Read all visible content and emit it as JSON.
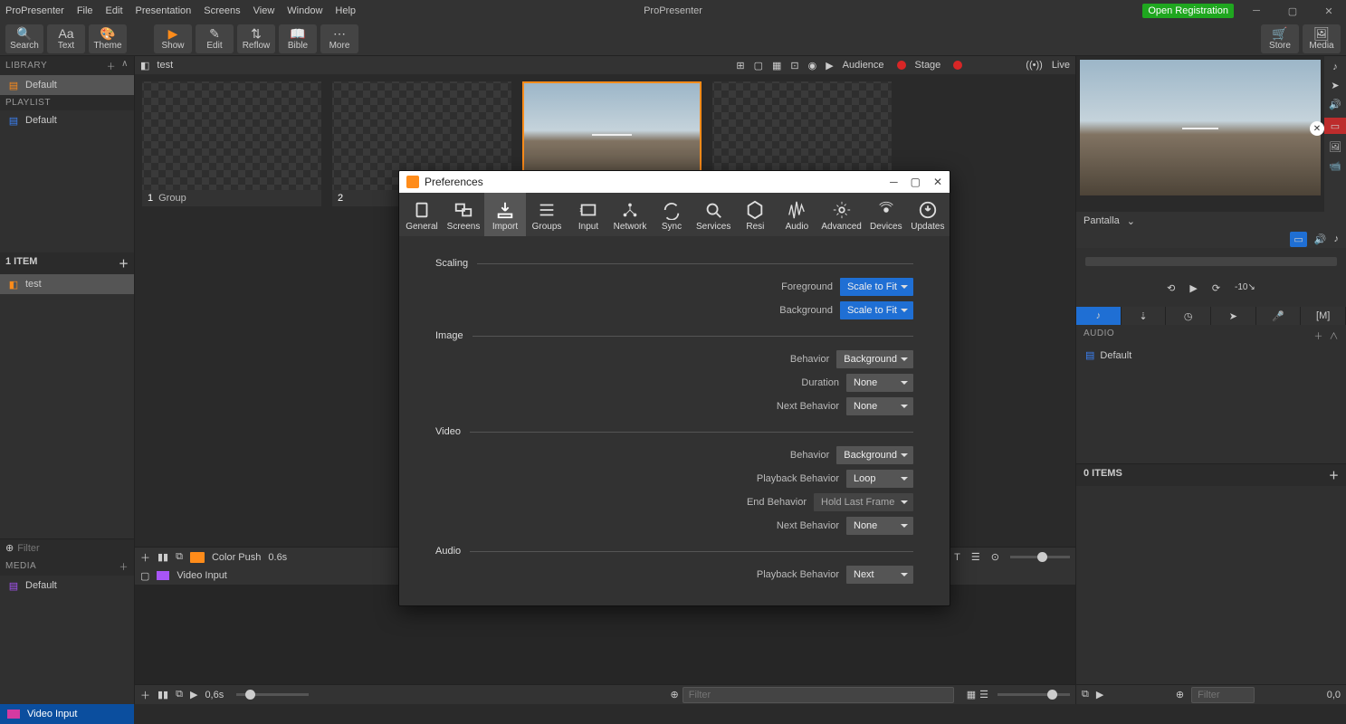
{
  "app": {
    "name": "ProPresenter",
    "title": "ProPresenter"
  },
  "menu": [
    "ProPresenter",
    "File",
    "Edit",
    "Presentation",
    "Screens",
    "View",
    "Window",
    "Help"
  ],
  "badge": "Open Registration",
  "toolbar": {
    "search": "Search",
    "text": "Text",
    "theme": "Theme",
    "show": "Show",
    "edit": "Edit",
    "reflow": "Reflow",
    "bible": "Bible",
    "more": "More",
    "store": "Store",
    "media": "Media"
  },
  "sidebar": {
    "library_label": "LIBRARY",
    "library_item": "Default",
    "playlist_label": "PLAYLIST",
    "playlist_item": "Default",
    "items_count": "1 ITEM",
    "item_name": "test",
    "filter_placeholder": "Filter",
    "media_label": "MEDIA",
    "media_item": "Default"
  },
  "center": {
    "doc_name": "test",
    "audience": "Audience",
    "stage": "Stage",
    "live": "Live",
    "slides": [
      {
        "num": "1",
        "grp": "Group"
      },
      {
        "num": "2",
        "grp": ""
      },
      {
        "num": "",
        "grp": ""
      },
      {
        "num": "",
        "grp": ""
      }
    ],
    "foot_transition": "Color Push",
    "foot_time": "0.6s"
  },
  "video_input": {
    "label": "Video Input",
    "time": "0,6s",
    "filter_placeholder": "Filter"
  },
  "right": {
    "output_label": "Pantalla",
    "audio_head": "AUDIO",
    "audio_item": "Default",
    "zero_items": "0 ITEMS",
    "filter_placeholder": "Filter",
    "coord": "0,0"
  },
  "status": {
    "label": "Video Input"
  },
  "modal": {
    "title": "Preferences",
    "tabs": [
      "General",
      "Screens",
      "Import",
      "Groups",
      "Input",
      "Network",
      "Sync",
      "Services",
      "Resi",
      "Audio",
      "Advanced",
      "Devices",
      "Updates"
    ],
    "sections": {
      "scaling": "Scaling",
      "image": "Image",
      "video": "Video",
      "audio": "Audio",
      "foreground": "Foreground",
      "background": "Background",
      "scale_to_fit": "Scale to Fit",
      "behavior": "Behavior",
      "duration": "Duration",
      "next_behavior": "Next Behavior",
      "background_val": "Background",
      "none": "None",
      "playback_behavior": "Playback Behavior",
      "loop": "Loop",
      "end_behavior": "End Behavior",
      "hold_last": "Hold Last Frame",
      "next": "Next"
    }
  }
}
